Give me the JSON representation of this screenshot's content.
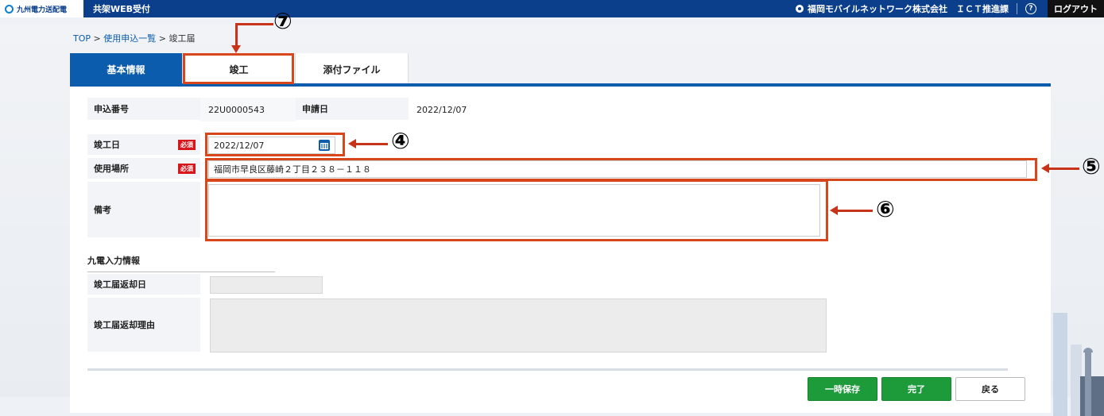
{
  "header": {
    "company_logo": "九州電力送配電",
    "app_title": "共架WEB受付",
    "user_org": "福岡モバイルネットワーク株式会社　ＩＣＴ推進課",
    "help_glyph": "?",
    "logout_label": "ログアウト"
  },
  "breadcrumb": {
    "top": "TOP",
    "sep1": " > ",
    "list": "使用申込一覧",
    "sep2": " > ",
    "current": "竣工届"
  },
  "tabs": [
    {
      "label": "基本情報",
      "active": true
    },
    {
      "label": "竣工",
      "active": false
    },
    {
      "label": "添付ファイル",
      "active": false
    }
  ],
  "form": {
    "app_no_label": "申込番号",
    "app_no_value": "22U0000543",
    "app_date_label": "申請日",
    "app_date_value": "2022/12/07",
    "completion_date_label": "竣工日",
    "completion_date_value": "2022/12/07",
    "location_label": "使用場所",
    "location_value": "福岡市早良区藤崎２丁目２３８－１１８",
    "remarks_label": "備考",
    "remarks_value": "",
    "required_badge": "必須"
  },
  "kyuden_section": {
    "title": "九電入力情報",
    "return_date_label": "竣工届返却日",
    "return_date_value": "",
    "return_reason_label": "竣工届返却理由",
    "return_reason_value": ""
  },
  "buttons": {
    "save_temp": "一時保存",
    "complete": "完了",
    "back": "戻る"
  },
  "annotations": {
    "c4": "④",
    "c5": "⑤",
    "c6": "⑥",
    "c7": "⑦"
  },
  "colors": {
    "header_bg": "#0b3f8c",
    "tab_active": "#0b5cad",
    "required": "#d7161c",
    "button_green": "#1d9a3a",
    "annotation": "#d8471c"
  }
}
